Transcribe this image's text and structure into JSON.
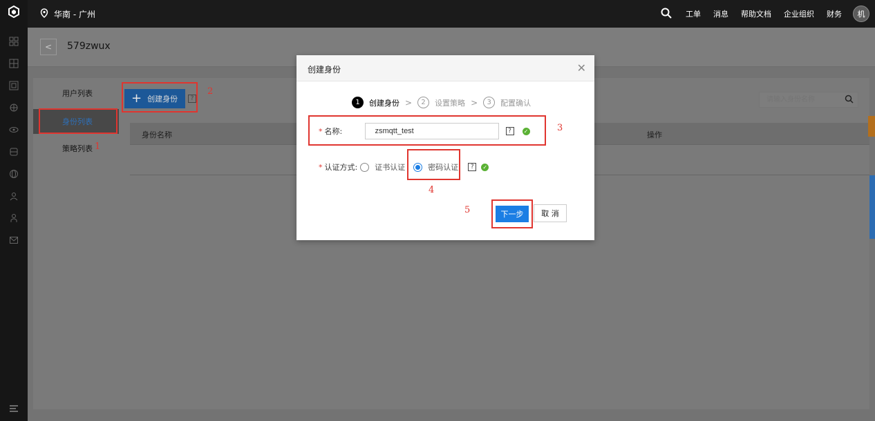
{
  "topbar": {
    "region": "华南 - 广州",
    "nav": [
      "工单",
      "消息",
      "帮助文档",
      "企业组织",
      "财务"
    ],
    "avatar": "机"
  },
  "subbar": {
    "title": "579zwux"
  },
  "sidebar": {
    "items": [
      "用户列表",
      "身份列表",
      "策略列表"
    ],
    "active": "身份列表"
  },
  "toolbar": {
    "create_label": "创建身份",
    "search_placeholder": "请输入身份名称"
  },
  "table": {
    "columns": [
      "身份名称",
      "操作"
    ]
  },
  "modal": {
    "title": "创建身份",
    "steps": [
      {
        "num": "1",
        "label": "创建身份"
      },
      {
        "num": "2",
        "label": "设置策略"
      },
      {
        "num": "3",
        "label": "配置确认"
      }
    ],
    "name_label": "名称:",
    "name_value": "zsmqtt_test",
    "auth_label": "认证方式:",
    "auth_options": [
      "证书认证",
      "密码认证"
    ],
    "auth_selected": "密码认证",
    "next_label": "下一步",
    "cancel_label": "取 消"
  },
  "annotations": [
    "1",
    "2",
    "3",
    "4",
    "5"
  ],
  "colors": {
    "accent": "#1b7ee4",
    "annotation_red": "#e0352f",
    "success": "#5ab134"
  }
}
